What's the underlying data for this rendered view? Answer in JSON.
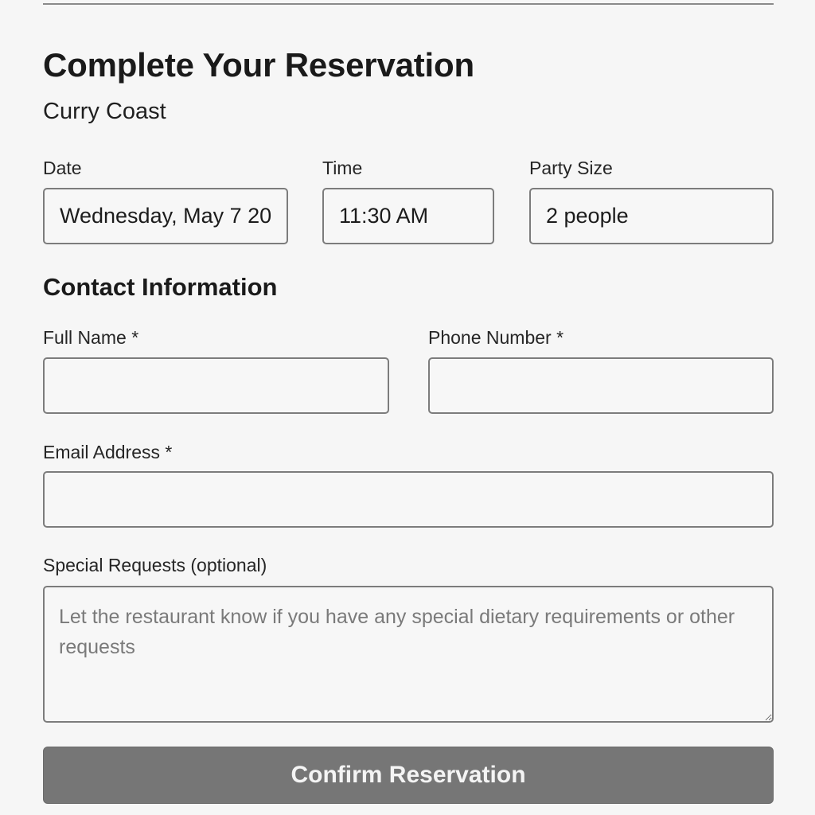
{
  "header": {
    "title": "Complete Your Reservation",
    "restaurant_name": "Curry Coast"
  },
  "booking": {
    "date_label": "Date",
    "date_value": "Wednesday, May 7 20",
    "time_label": "Time",
    "time_value": "11:30 AM",
    "party_label": "Party Size",
    "party_value": "2 people"
  },
  "contact": {
    "heading": "Contact Information",
    "full_name_label": "Full Name *",
    "full_name_value": "",
    "phone_label": "Phone Number *",
    "phone_value": "",
    "email_label": "Email Address *",
    "email_value": "",
    "requests_label": "Special Requests (optional)",
    "requests_placeholder": "Let the restaurant know if you have any special dietary requirements or other requests"
  },
  "actions": {
    "confirm_label": "Confirm Reservation"
  },
  "colors": {
    "button_bg": "#767676",
    "button_text": "#f4f4f4",
    "border": "#7c7c7c",
    "page_bg": "#f6f6f6"
  }
}
